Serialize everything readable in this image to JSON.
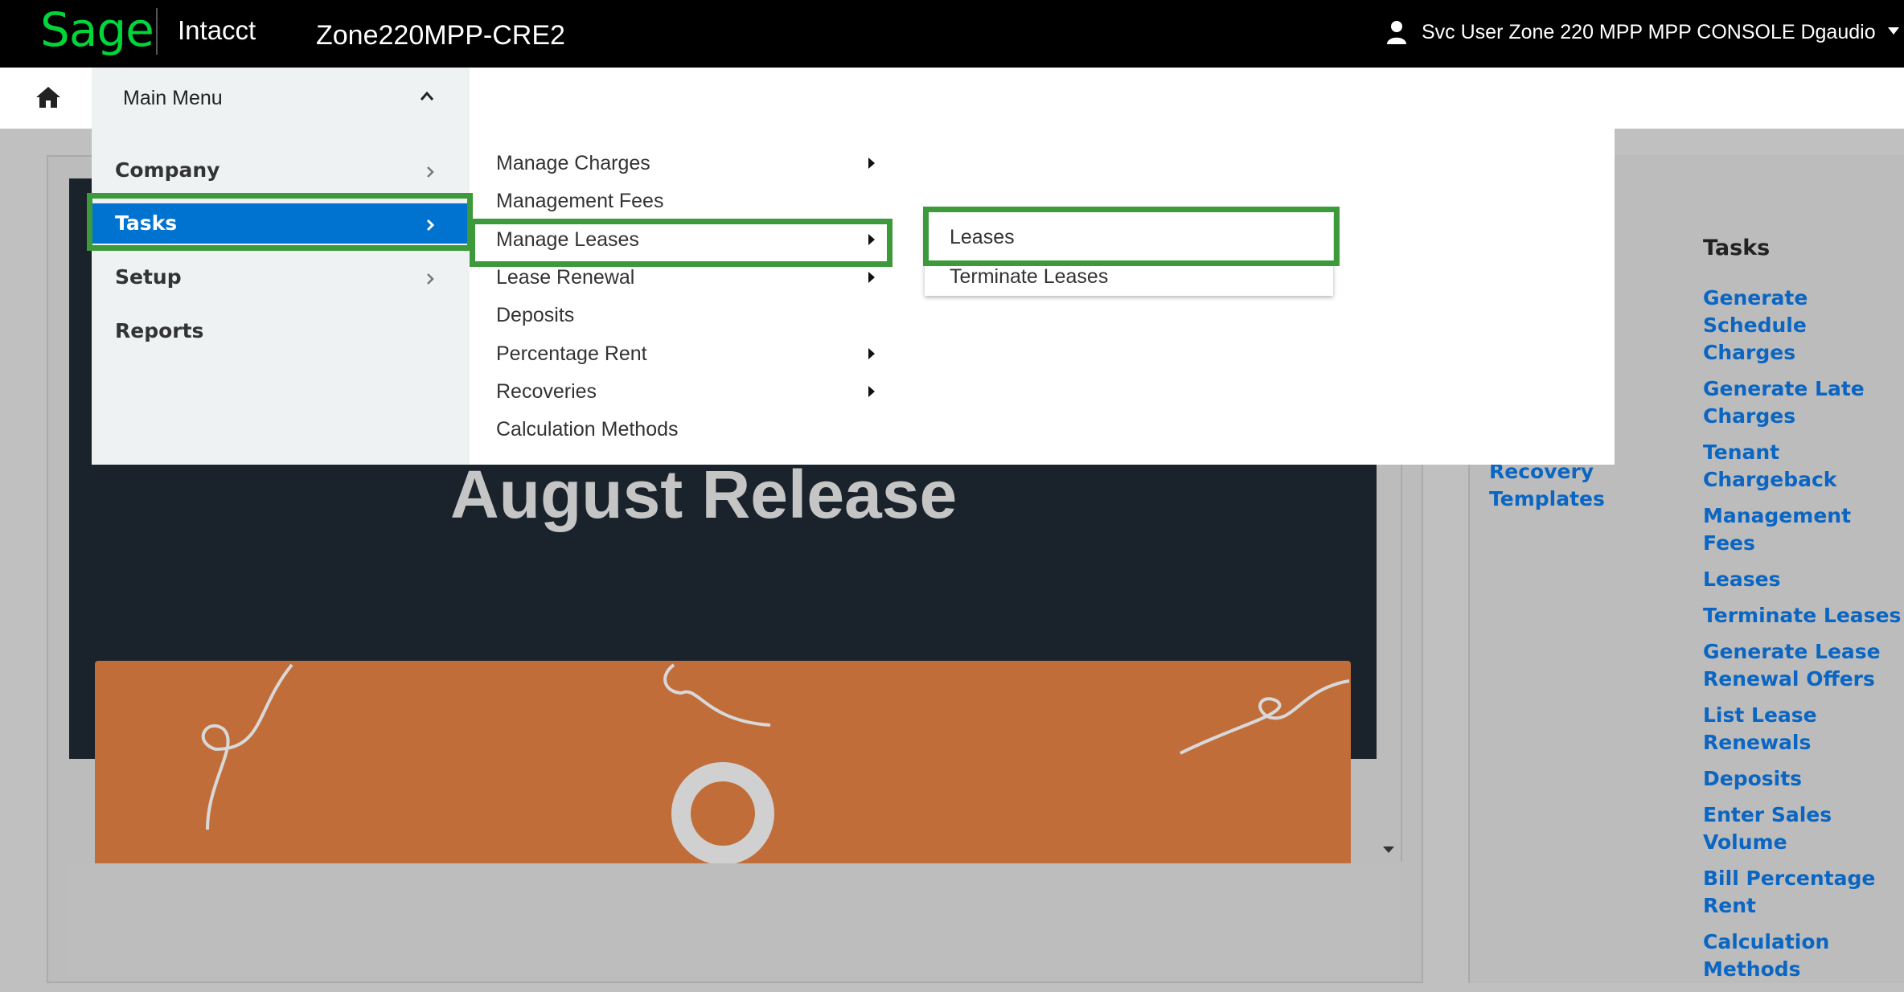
{
  "header": {
    "logo_text": "Sage",
    "product_name": "Intacct",
    "company": "Zone220MPP-CRE2",
    "user_name": "Svc User Zone 220 MPP MPP CONSOLE Dgaudio"
  },
  "nav": {
    "main_menu_label": "Main Menu"
  },
  "menu": {
    "level1": [
      {
        "label": "Company",
        "has_submenu": true
      },
      {
        "label": "Tasks",
        "has_submenu": true,
        "selected": true
      },
      {
        "label": "Setup",
        "has_submenu": true
      },
      {
        "label": "Reports",
        "has_submenu": false
      }
    ],
    "level2": [
      {
        "label": "Manage Charges",
        "has_submenu": true
      },
      {
        "label": "Management Fees",
        "has_submenu": false
      },
      {
        "label": "Manage Leases",
        "has_submenu": true,
        "selected": true
      },
      {
        "label": "Lease Renewal",
        "has_submenu": true
      },
      {
        "label": "Deposits",
        "has_submenu": false
      },
      {
        "label": "Percentage Rent",
        "has_submenu": true
      },
      {
        "label": "Recoveries",
        "has_submenu": true
      },
      {
        "label": "Calculation Methods",
        "has_submenu": false
      }
    ],
    "level3": [
      {
        "label": "Leases"
      },
      {
        "label": "Terminate Leases"
      }
    ]
  },
  "banner": {
    "title": "August Release"
  },
  "right_panel": {
    "recovery_link": "Recovery Templates",
    "tasks_heading": "Tasks",
    "tasks_links": [
      "Generate Schedule Charges",
      "Generate Late Charges",
      "Tenant Chargeback",
      "Management Fees",
      "Leases",
      "Terminate Leases",
      "Generate Lease Renewal Offers",
      "List Lease Renewals",
      "Deposits",
      "Enter Sales Volume",
      "Bill Percentage Rent",
      "Calculation Methods"
    ]
  },
  "colors": {
    "brand_green": "#00d639",
    "selected_blue": "#0073d1",
    "highlight_green": "#3c9a3a",
    "link_blue": "#0a66c2",
    "banner_orange": "#c06d3a"
  },
  "icons": [
    "home-icon",
    "user-icon",
    "chevron-up-icon",
    "chevron-right-icon",
    "caret-right-icon",
    "caret-down-icon"
  ]
}
